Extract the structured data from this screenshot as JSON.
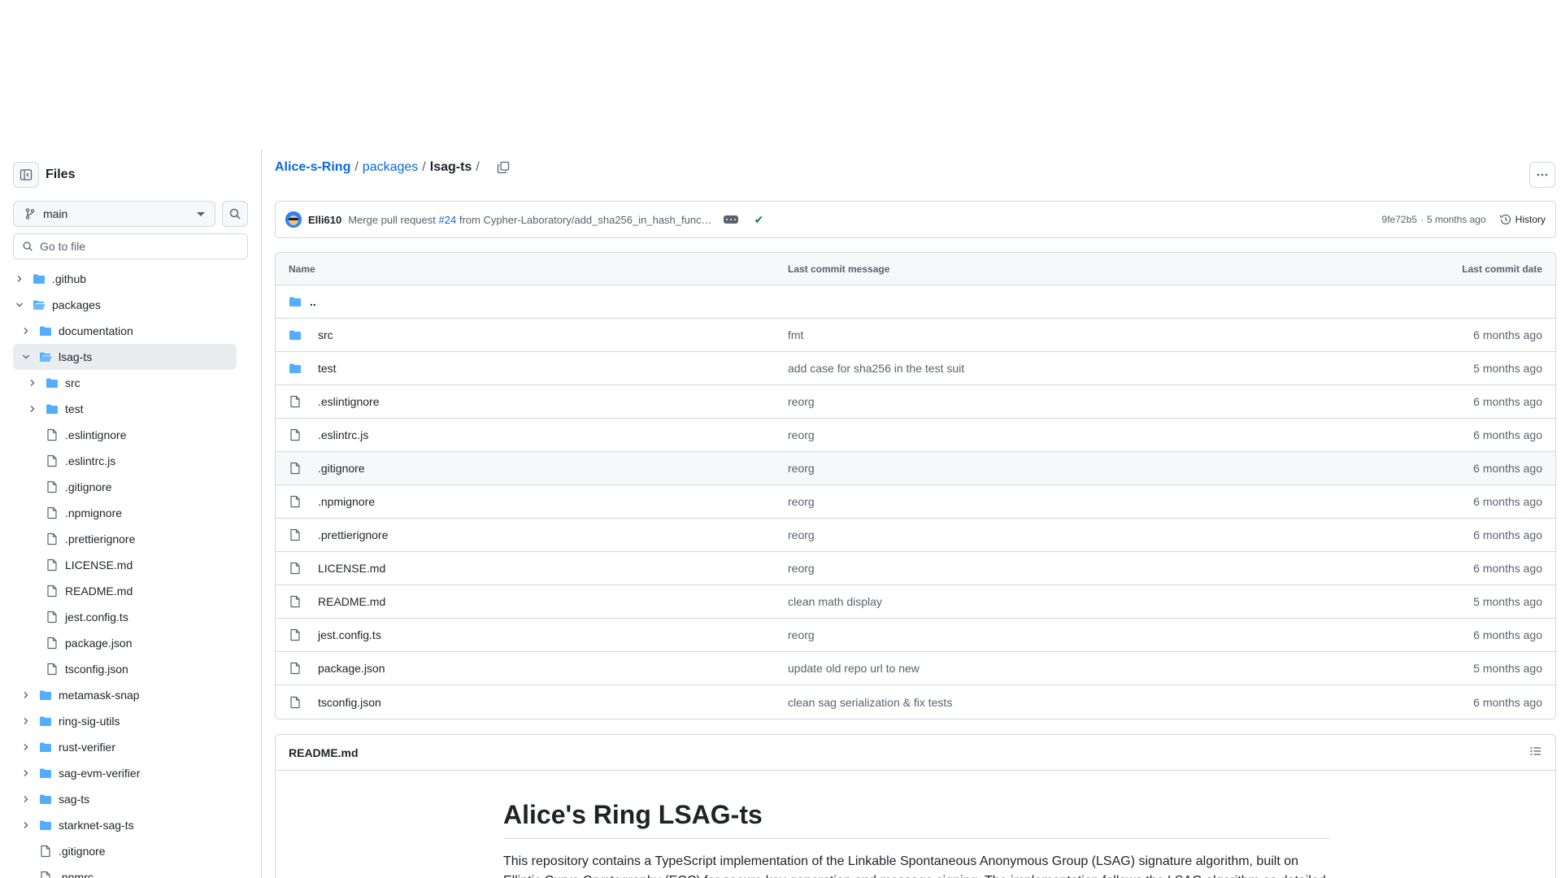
{
  "sidebar": {
    "title": "Files",
    "branch": "main",
    "goto_placeholder": "Go to file",
    "tree": [
      {
        "label": ".github",
        "type": "folder",
        "depth": 0,
        "expanded": false,
        "selected": false
      },
      {
        "label": "packages",
        "type": "folder",
        "depth": 0,
        "expanded": true,
        "selected": false
      },
      {
        "label": "documentation",
        "type": "folder",
        "depth": 1,
        "expanded": false,
        "selected": false
      },
      {
        "label": "lsag-ts",
        "type": "folder",
        "depth": 1,
        "expanded": true,
        "selected": true
      },
      {
        "label": "src",
        "type": "folder",
        "depth": 2,
        "expanded": false,
        "selected": false
      },
      {
        "label": "test",
        "type": "folder",
        "depth": 2,
        "expanded": false,
        "selected": false
      },
      {
        "label": ".eslintignore",
        "type": "file",
        "depth": 2,
        "selected": false
      },
      {
        "label": ".eslintrc.js",
        "type": "file",
        "depth": 2,
        "selected": false
      },
      {
        "label": ".gitignore",
        "type": "file",
        "depth": 2,
        "selected": false
      },
      {
        "label": ".npmignore",
        "type": "file",
        "depth": 2,
        "selected": false
      },
      {
        "label": ".prettierignore",
        "type": "file",
        "depth": 2,
        "selected": false
      },
      {
        "label": "LICENSE.md",
        "type": "file",
        "depth": 2,
        "selected": false
      },
      {
        "label": "README.md",
        "type": "file",
        "depth": 2,
        "selected": false
      },
      {
        "label": "jest.config.ts",
        "type": "file",
        "depth": 2,
        "selected": false
      },
      {
        "label": "package.json",
        "type": "file",
        "depth": 2,
        "selected": false
      },
      {
        "label": "tsconfig.json",
        "type": "file",
        "depth": 2,
        "selected": false
      },
      {
        "label": "metamask-snap",
        "type": "folder",
        "depth": 1,
        "expanded": false,
        "selected": false
      },
      {
        "label": "ring-sig-utils",
        "type": "folder",
        "depth": 1,
        "expanded": false,
        "selected": false
      },
      {
        "label": "rust-verifier",
        "type": "folder",
        "depth": 1,
        "expanded": false,
        "selected": false
      },
      {
        "label": "sag-evm-verifier",
        "type": "folder",
        "depth": 1,
        "expanded": false,
        "selected": false
      },
      {
        "label": "sag-ts",
        "type": "folder",
        "depth": 1,
        "expanded": false,
        "selected": false
      },
      {
        "label": "starknet-sag-ts",
        "type": "folder",
        "depth": 1,
        "expanded": false,
        "selected": false
      },
      {
        "label": ".gitignore",
        "type": "file",
        "depth": 1,
        "selected": false
      },
      {
        "label": ".npmrc",
        "type": "file",
        "depth": 1,
        "selected": false
      }
    ]
  },
  "breadcrumb": {
    "repo": "Alice-s-Ring",
    "folder": "packages",
    "current": "lsag-ts",
    "sep": "/"
  },
  "commit": {
    "author": "Elli610",
    "message_prefix": "Merge pull request",
    "pr": "#24",
    "message_suffix": "from Cypher-Laboratory/add_sha256_in_hash_func…",
    "sha": "9fe72b5",
    "dot": "·",
    "time": "5 months ago",
    "history_label": "History"
  },
  "table": {
    "headers": {
      "name": "Name",
      "message": "Last commit message",
      "date": "Last commit date"
    },
    "parent": "..",
    "rows": [
      {
        "name": "src",
        "type": "folder",
        "message": "fmt",
        "date": "6 months ago"
      },
      {
        "name": "test",
        "type": "folder",
        "message": "add case for sha256 in the test suit",
        "date": "5 months ago"
      },
      {
        "name": ".eslintignore",
        "type": "file",
        "message": "reorg",
        "date": "6 months ago"
      },
      {
        "name": ".eslintrc.js",
        "type": "file",
        "message": "reorg",
        "date": "6 months ago"
      },
      {
        "name": ".gitignore",
        "type": "file",
        "message": "reorg",
        "date": "6 months ago"
      },
      {
        "name": ".npmignore",
        "type": "file",
        "message": "reorg",
        "date": "6 months ago"
      },
      {
        "name": ".prettierignore",
        "type": "file",
        "message": "reorg",
        "date": "6 months ago"
      },
      {
        "name": "LICENSE.md",
        "type": "file",
        "message": "reorg",
        "date": "6 months ago"
      },
      {
        "name": "README.md",
        "type": "file",
        "message": "clean math display",
        "date": "5 months ago"
      },
      {
        "name": "jest.config.ts",
        "type": "file",
        "message": "reorg",
        "date": "6 months ago"
      },
      {
        "name": "package.json",
        "type": "file",
        "message": "update old repo url to new",
        "date": "5 months ago"
      },
      {
        "name": "tsconfig.json",
        "type": "file",
        "message": "clean sag serialization & fix tests",
        "date": "6 months ago"
      }
    ]
  },
  "readme": {
    "filename": "README.md",
    "heading": "Alice's Ring LSAG-ts",
    "paragraph": "This repository contains a TypeScript implementation of the Linkable Spontaneous Anonymous Group (LSAG) signature algorithm, built on Elliptic Curve Cryptography (ECC) for secure key generation and message signing. The implementation follows the LSAG algorithm as detailed"
  },
  "colors": {
    "accent": "#0969da",
    "folder": "#54aeff",
    "success": "#1a7f37",
    "muted": "#59636e",
    "border": "#d1d9e0"
  }
}
